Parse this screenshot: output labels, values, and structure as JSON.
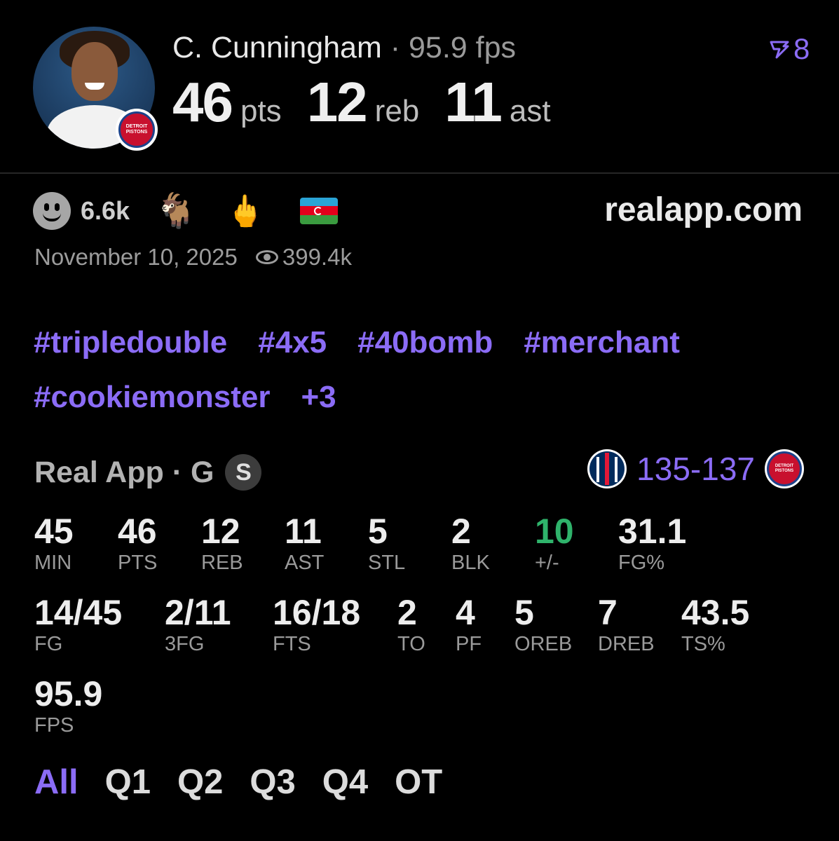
{
  "header": {
    "player_name": "C. Cunningham",
    "separator": "·",
    "fps_label": "95.9 fps",
    "boost_count": "8",
    "big_stats": [
      {
        "value": "46",
        "unit": "pts"
      },
      {
        "value": "12",
        "unit": "reb"
      },
      {
        "value": "11",
        "unit": "ast"
      }
    ],
    "team_badge_text": "DETROIT PISTONS"
  },
  "reactions": {
    "count": "6.6k",
    "emoji_goat": "🐐",
    "emoji_finger": "🖕"
  },
  "site": "realapp.com",
  "meta": {
    "date": "November 10, 2025",
    "views": "399.4k"
  },
  "tags": [
    "#tripledouble",
    "#4x5",
    "#40bomb",
    "#merchant",
    "#cookiemonster",
    "+3"
  ],
  "game": {
    "source": "Real App · G",
    "badge": "S",
    "score": "135-137"
  },
  "stats": [
    {
      "value": "45",
      "label": "MIN"
    },
    {
      "value": "46",
      "label": "PTS"
    },
    {
      "value": "12",
      "label": "REB"
    },
    {
      "value": "11",
      "label": "AST"
    },
    {
      "value": "5",
      "label": "STL"
    },
    {
      "value": "2",
      "label": "BLK"
    },
    {
      "value": "10",
      "label": "+/-"
    },
    {
      "value": "31.1",
      "label": "FG%"
    },
    {
      "value": "14/45",
      "label": "FG"
    },
    {
      "value": "2/11",
      "label": "3FG"
    },
    {
      "value": "16/18",
      "label": "FTS"
    },
    {
      "value": "2",
      "label": "TO"
    },
    {
      "value": "4",
      "label": "PF"
    },
    {
      "value": "5",
      "label": "OREB"
    },
    {
      "value": "7",
      "label": "DREB"
    },
    {
      "value": "43.5",
      "label": "TS%"
    },
    {
      "value": "95.9",
      "label": "FPS"
    }
  ],
  "periods": [
    "All",
    "Q1",
    "Q2",
    "Q3",
    "Q4",
    "OT"
  ],
  "colors": {
    "accent": "#8b6cf6",
    "positive": "#2fb36b",
    "background": "#000000"
  }
}
